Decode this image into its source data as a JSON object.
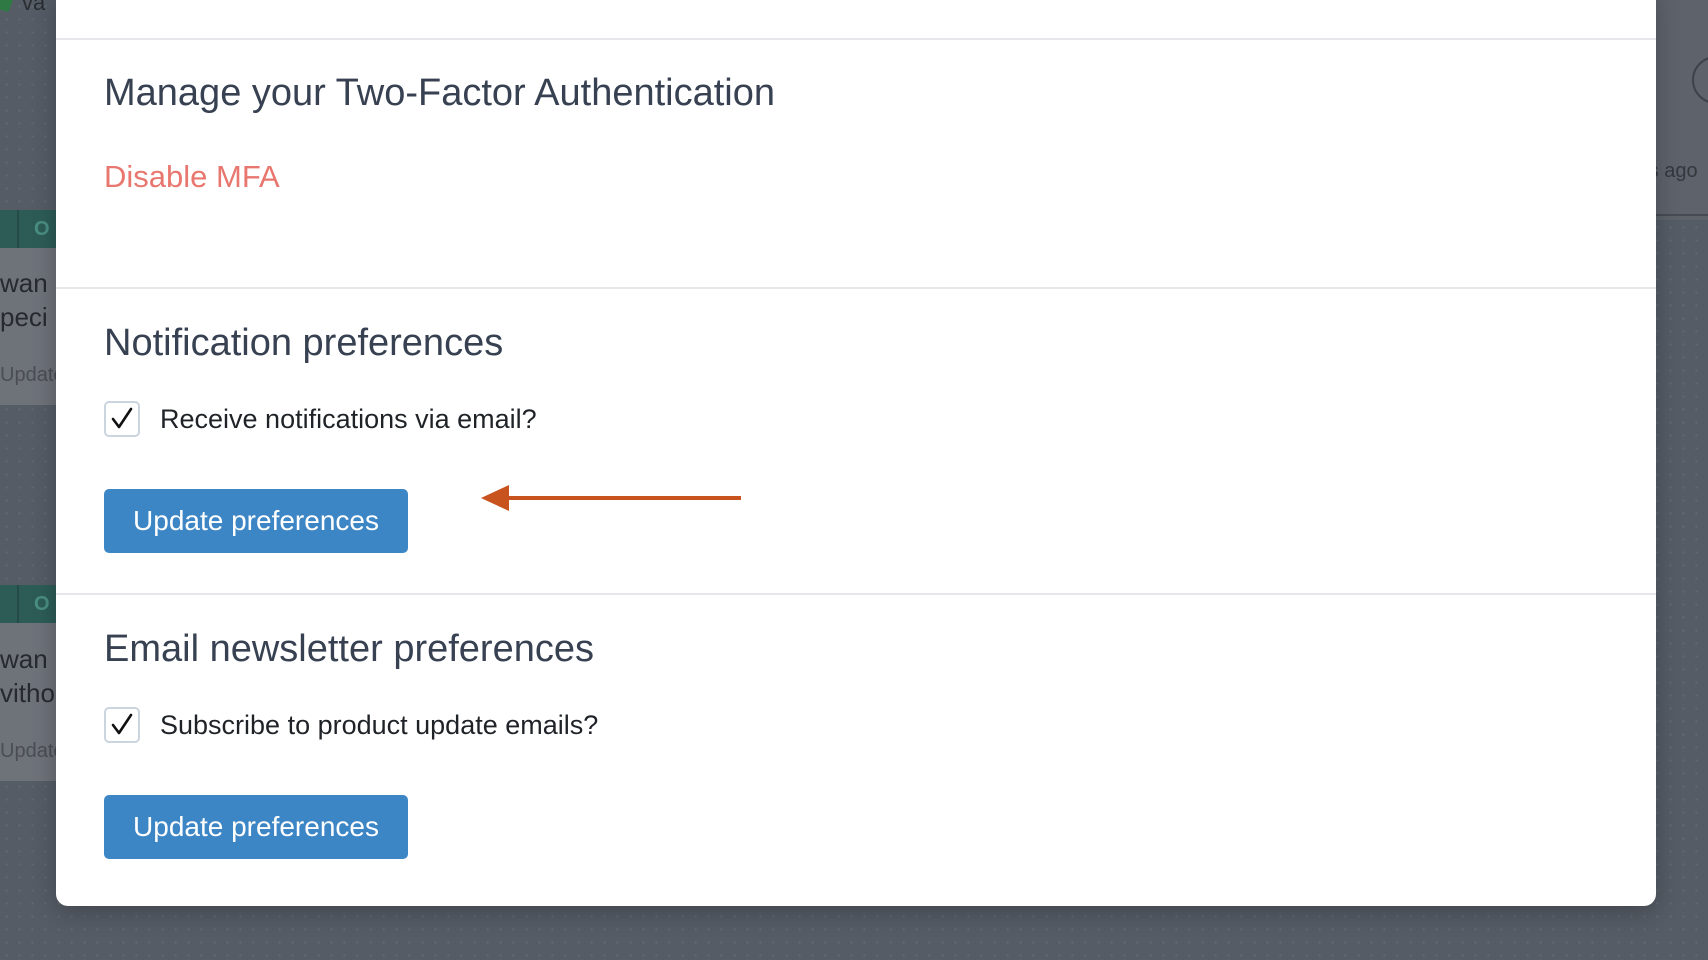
{
  "background": {
    "top_text": "va",
    "card_tag": "O",
    "card1_lines": [
      "wan",
      "peci"
    ],
    "card2_lines": [
      "wan",
      "vitho"
    ],
    "updated_text": "Update",
    "right_text": "rs ago"
  },
  "mfa": {
    "title": "Manage your Two-Factor Authentication",
    "disable_link": "Disable MFA"
  },
  "notifications": {
    "title": "Notification preferences",
    "checkbox_label": "Receive notifications via email?",
    "checked": true,
    "button_label": "Update preferences"
  },
  "newsletter": {
    "title": "Email newsletter preferences",
    "checkbox_label": "Subscribe to product update emails?",
    "checked": true,
    "button_label": "Update preferences"
  },
  "colors": {
    "primary_button": "#3d86c6",
    "danger_link": "#e8776f",
    "annotation_arrow": "#c8531f",
    "overlay": "#565c66"
  }
}
